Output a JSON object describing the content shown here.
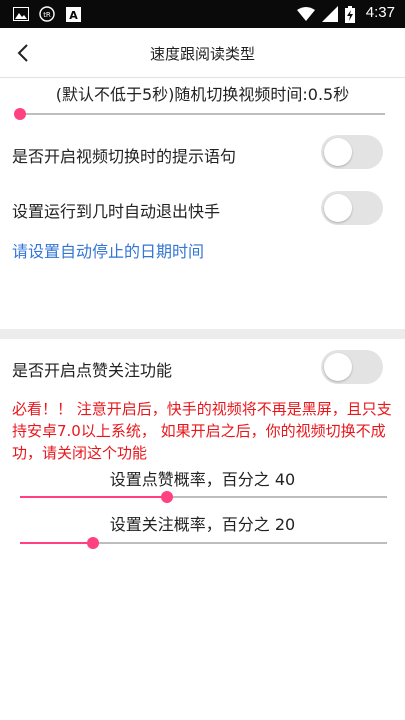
{
  "status_bar": {
    "time": "4:37",
    "icons": [
      "image-notification-icon",
      "r-badge-icon",
      "a-notification-icon",
      "wifi-icon",
      "signal-icon",
      "battery-charging-icon"
    ]
  },
  "header": {
    "title": "速度跟阅读类型"
  },
  "video_switch_slider": {
    "label": "(默认不低于5秒)随机切换视频时间:0.5秒",
    "value_fraction": 0.0
  },
  "settings": {
    "switch_hint_label": "是否开启视频切换时的提示语句",
    "switch_hint_on": false,
    "auto_exit_label": "设置运行到几时自动退出快手",
    "auto_exit_on": false,
    "stop_date_link": "请设置自动停止的日期时间"
  },
  "like_follow": {
    "label": "是否开启点赞关注功能",
    "on": false,
    "warning": "必看！！ 注意开启后，快手的视频将不再是黑屏，且只支持安卓7.0以上系统，         如果开启之后，你的视频切换不成功，请关闭这个功能"
  },
  "like_rate": {
    "label": "设置点赞概率，百分之 40",
    "percent": 40
  },
  "follow_rate": {
    "label": "设置关注概率，百分之 20",
    "percent": 20
  },
  "colors": {
    "accent": "#ff4081",
    "link": "#3376d6",
    "warning": "#e8171c",
    "statusbar": "#0a0a0a"
  }
}
